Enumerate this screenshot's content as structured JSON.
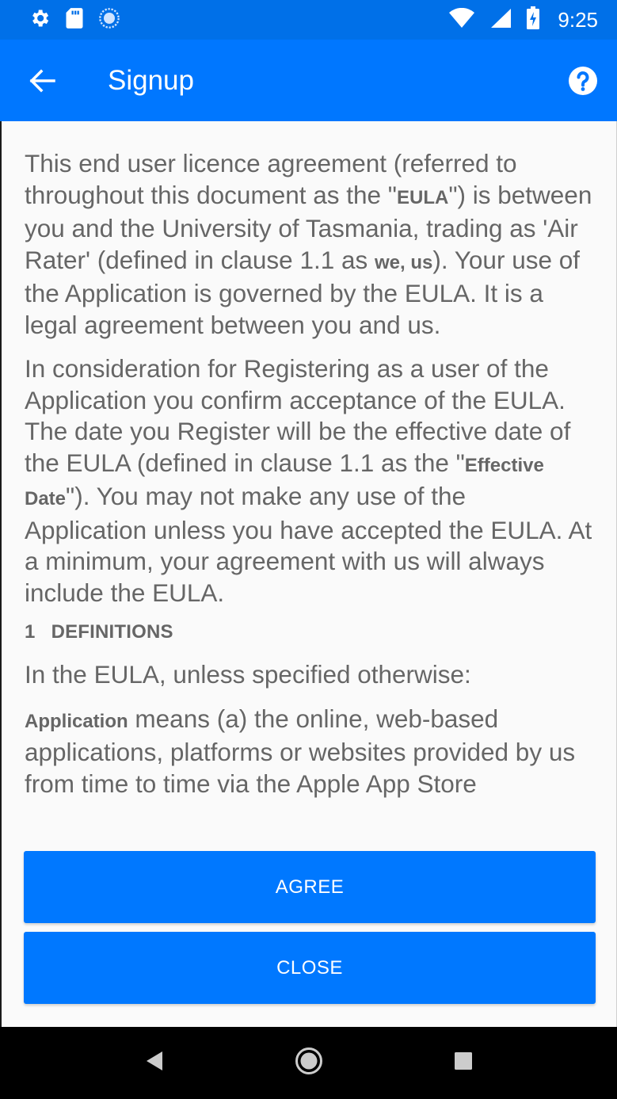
{
  "status_bar": {
    "time": "9:25",
    "icons": [
      "gear-icon",
      "sd-card-icon",
      "sync-icon",
      "wifi-icon",
      "signal-icon",
      "battery-charging-icon"
    ]
  },
  "app_bar": {
    "title": "Signup",
    "back_icon": "back-arrow-icon",
    "help_icon": "help-icon"
  },
  "eula": {
    "p1": {
      "a": "This end user licence agreement (referred to throughout this document as the \"",
      "term1": "EULA",
      "b": "\") is between you and the University of Tasmania, trading as 'Air Rater' (defined in clause 1.1 as ",
      "term2": "we, us",
      "c": "). Your use of the Application is governed by the EULA. It is a legal agreement between you and us."
    },
    "p2": {
      "a": "In consideration for Registering as a user of the Application you confirm acceptance of the EULA. The date you Register will be the effective date of the EULA (defined in clause 1.1 as the \"",
      "term": "Effective Date",
      "b": "\"). You may not make any use of the Application unless you have accepted the EULA. At a minimum, your agreement with us will always include the EULA."
    },
    "heading": {
      "number": "1",
      "title": "DEFINITIONS"
    },
    "p3": "In the EULA, unless specified otherwise:",
    "p4": {
      "term": "Application",
      "text": " means (a) the online, web-based applications, platforms or websites provided by us from time to time via the Apple App Store"
    }
  },
  "buttons": {
    "agree": "AGREE",
    "close": "CLOSE"
  },
  "nav_bar": {
    "icons": [
      "nav-back-icon",
      "nav-home-icon",
      "nav-recents-icon"
    ]
  },
  "colors": {
    "status_bar": "#0070e8",
    "app_bar": "#0077ff",
    "button": "#0078ff",
    "body_text": "#666666"
  }
}
